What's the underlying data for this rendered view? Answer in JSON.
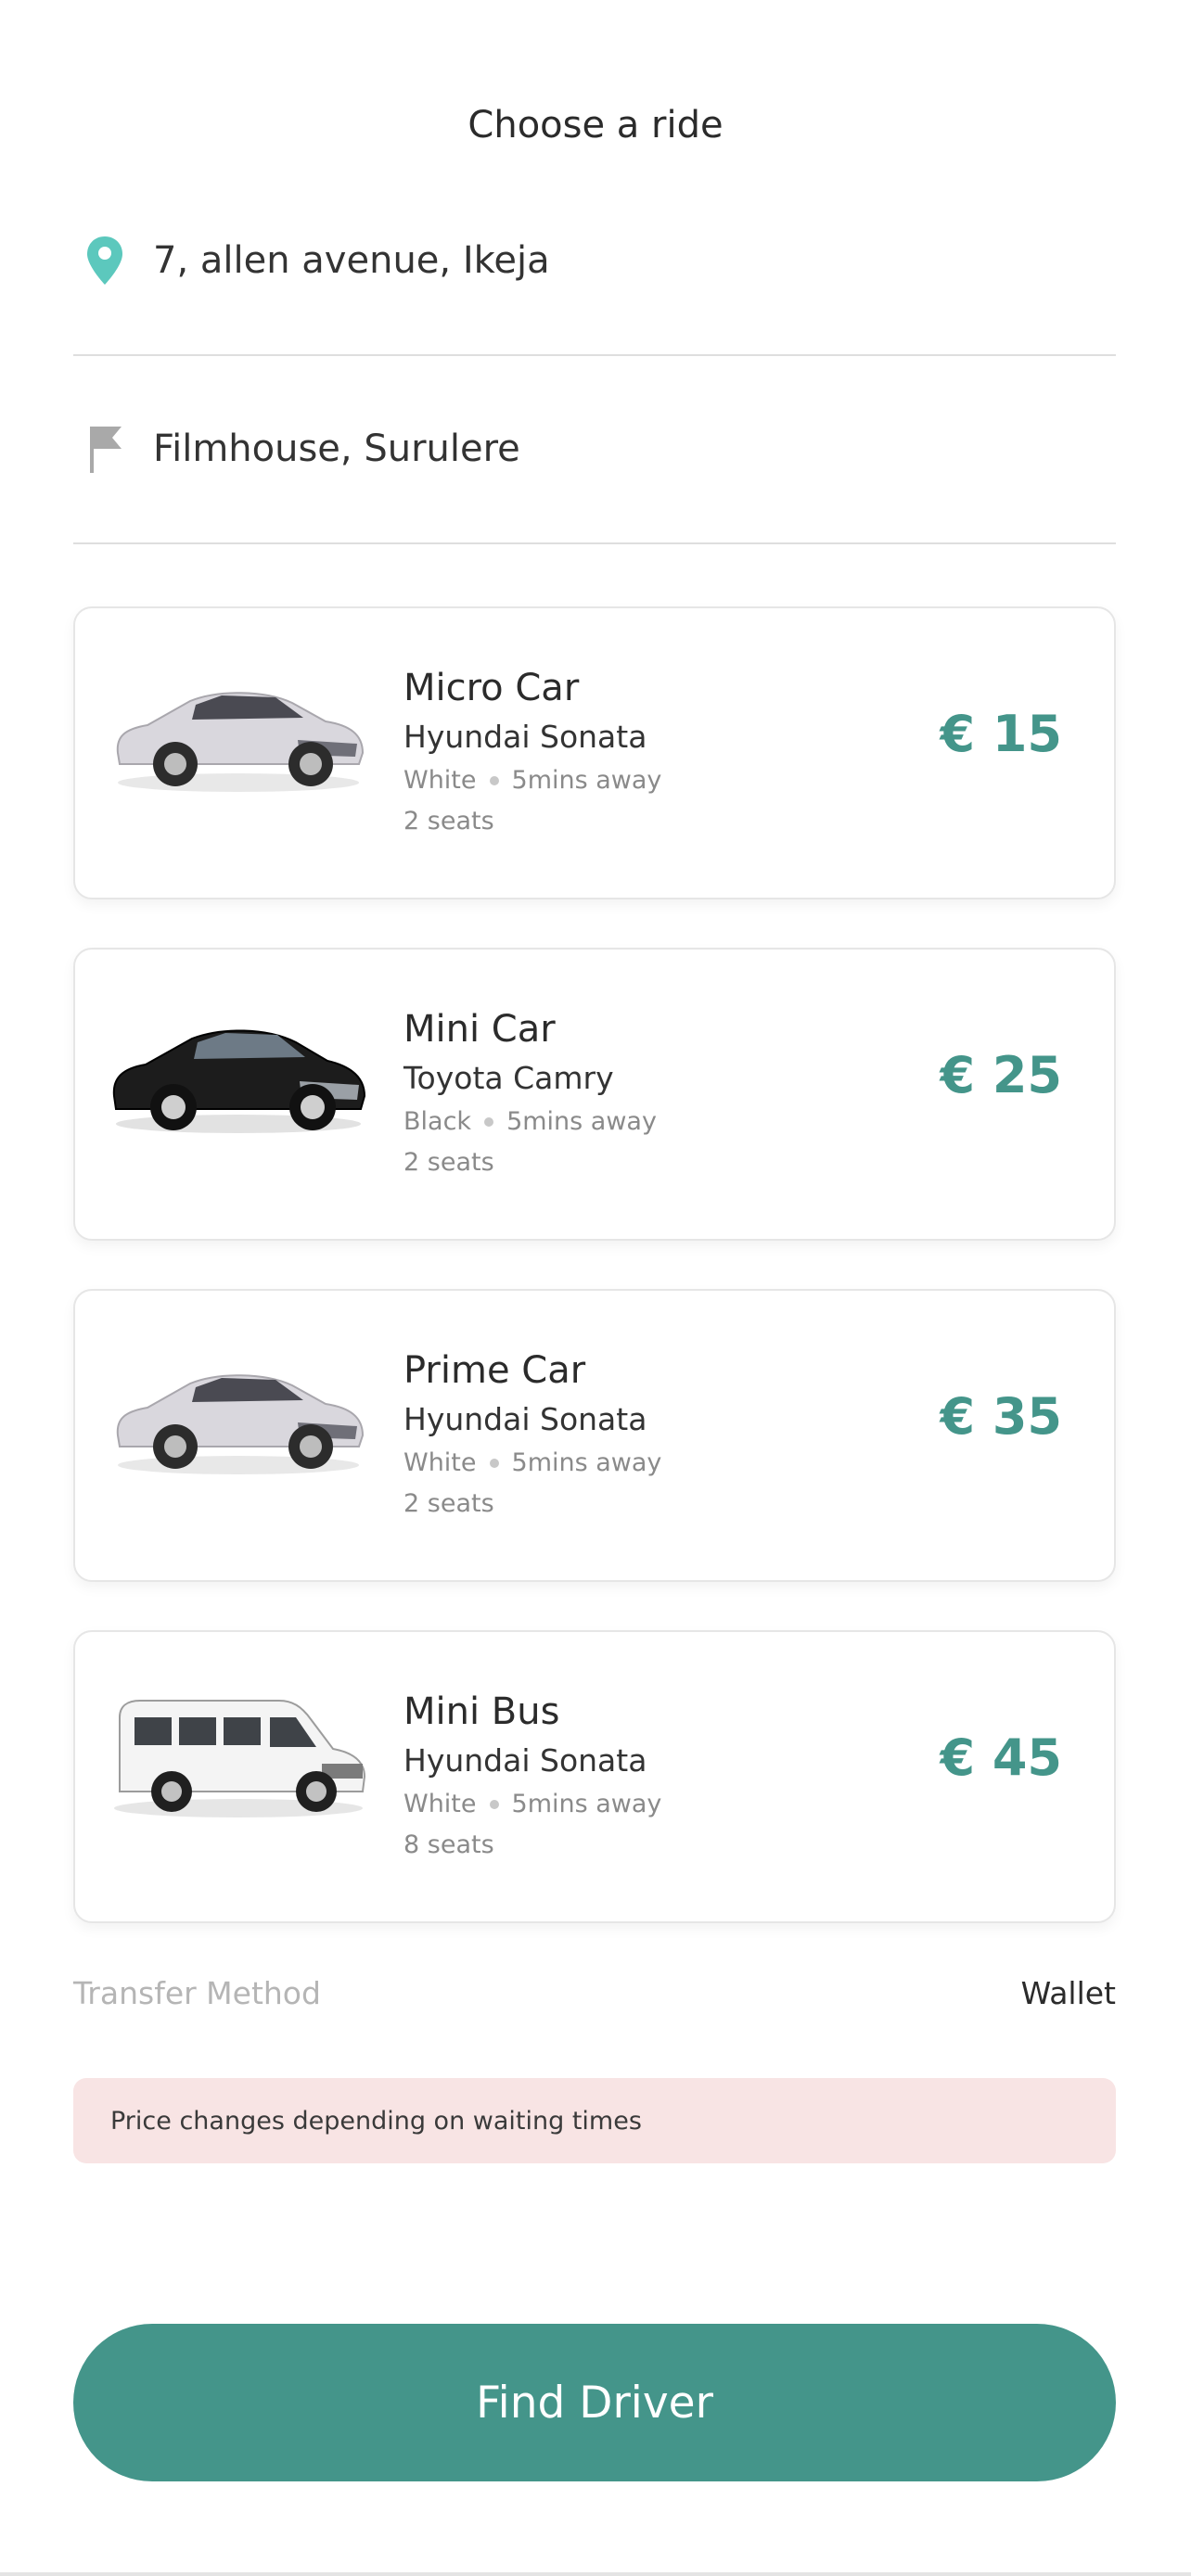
{
  "header": {
    "title": "Choose a ride"
  },
  "locations": {
    "pickup": {
      "text": "7, allen avenue, Ikeja",
      "icon": "location-pin-icon"
    },
    "dropoff": {
      "text": "Filmhouse, Surulere",
      "icon": "flag-icon"
    }
  },
  "rides": [
    {
      "name": "Micro Car",
      "model": "Hyundai Sonata",
      "color": "White",
      "eta": "5mins away",
      "seats": "2 seats",
      "price": "€ 15",
      "image": "silver-sedan"
    },
    {
      "name": "Mini Car",
      "model": "Toyota Camry",
      "color": "Black",
      "eta": "5mins away",
      "seats": "2 seats",
      "price": "€ 25",
      "image": "black-sedan"
    },
    {
      "name": "Prime Car",
      "model": "Hyundai Sonata",
      "color": "White",
      "eta": "5mins away",
      "seats": "2 seats",
      "price": "€ 35",
      "image": "silver-sedan"
    },
    {
      "name": "Mini Bus",
      "model": "Hyundai Sonata",
      "color": "White",
      "eta": "5mins away",
      "seats": "8 seats",
      "price": "€ 45",
      "image": "white-van"
    }
  ],
  "transfer": {
    "label": "Transfer Method",
    "value": "Wallet"
  },
  "notice": {
    "text": "Price changes depending on waiting times"
  },
  "cta": {
    "label": "Find Driver"
  },
  "colors": {
    "accent": "#44958a",
    "pin": "#5cc8bd",
    "notice_bg": "#f8e4e4"
  }
}
